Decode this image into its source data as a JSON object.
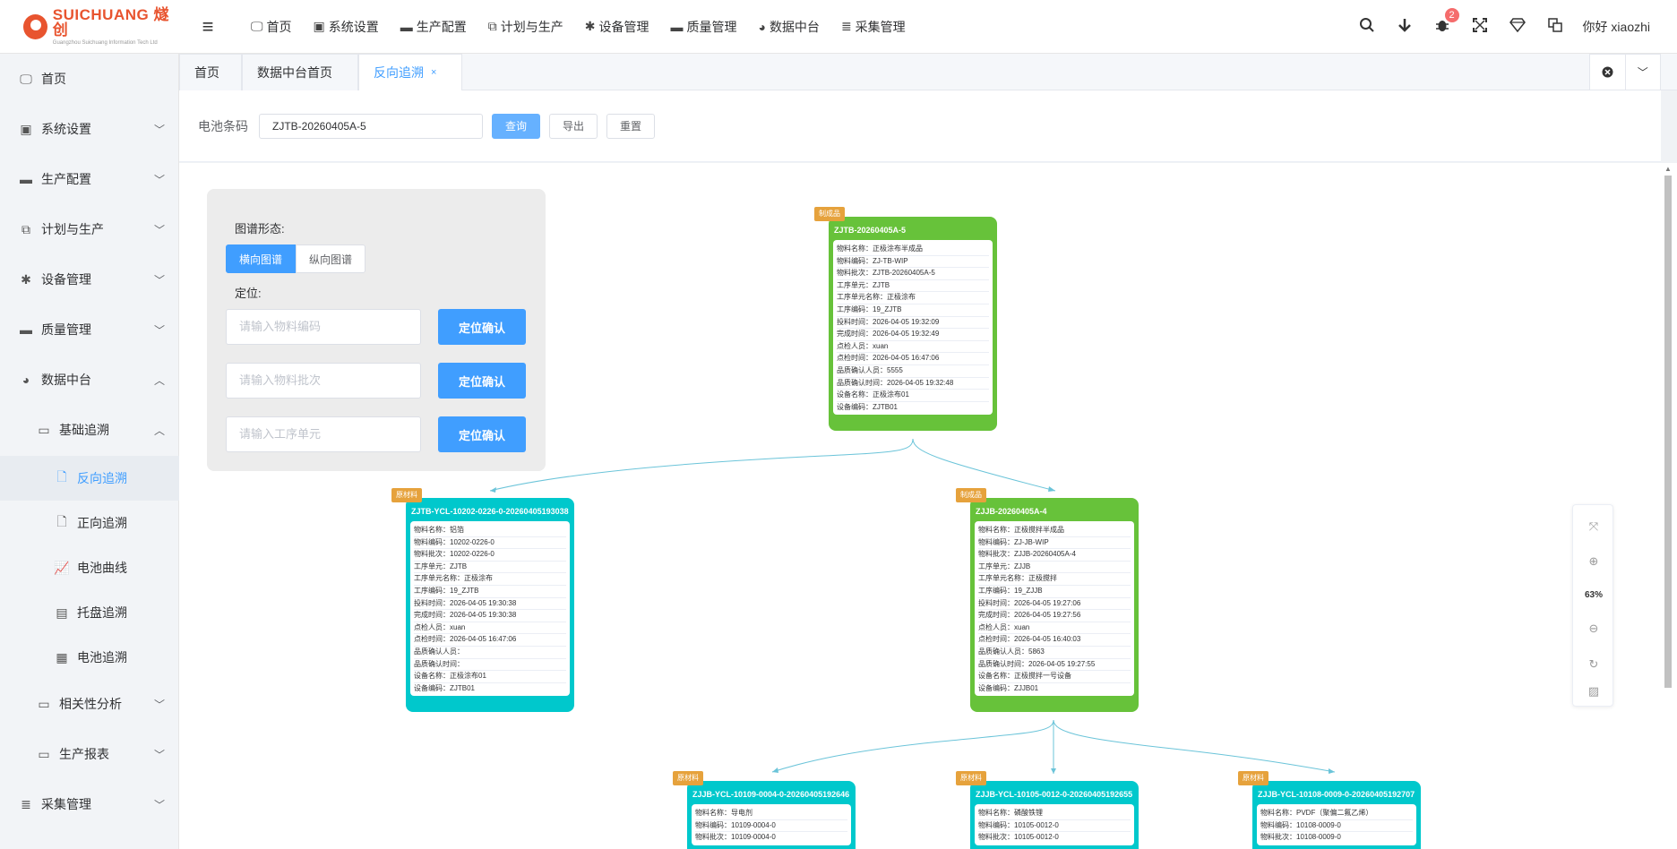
{
  "header": {
    "brand": "SUICHUANG 燧创",
    "brand_sub": "Guangzhou Suichuang Information Tech Ltd",
    "nav": [
      {
        "label": "首页",
        "icon": "monitor-icon",
        "glyph": "🖵"
      },
      {
        "label": "系统设置",
        "icon": "user-settings-icon",
        "glyph": "▣"
      },
      {
        "label": "生产配置",
        "icon": "briefcase-icon",
        "glyph": "▬"
      },
      {
        "label": "计划与生产",
        "icon": "windows-icon",
        "glyph": "⧉"
      },
      {
        "label": "设备管理",
        "icon": "gear-icon",
        "glyph": "✱"
      },
      {
        "label": "质量管理",
        "icon": "briefcase-icon",
        "glyph": "▬"
      },
      {
        "label": "数据中台",
        "icon": "pie-chart-icon",
        "glyph": "◕"
      },
      {
        "label": "采集管理",
        "icon": "database-icon",
        "glyph": "≣"
      }
    ],
    "notification_count": "2",
    "greeting": "你好 xiaozhi"
  },
  "sidebar": {
    "items": [
      {
        "label": "首页",
        "glyph": "🖵"
      },
      {
        "label": "系统设置",
        "glyph": "▣"
      },
      {
        "label": "生产配置",
        "glyph": "▬"
      },
      {
        "label": "计划与生产",
        "glyph": "⧉"
      },
      {
        "label": "设备管理",
        "glyph": "✱"
      },
      {
        "label": "质量管理",
        "glyph": "▬"
      },
      {
        "label": "数据中台",
        "glyph": "◕"
      },
      {
        "label": "基础追溯",
        "glyph": "▭"
      },
      {
        "label": "反向追溯",
        "glyph": "🗋"
      },
      {
        "label": "正向追溯",
        "glyph": "🗋"
      },
      {
        "label": "电池曲线",
        "glyph": "📈"
      },
      {
        "label": "托盘追溯",
        "glyph": "▤"
      },
      {
        "label": "电池追溯",
        "glyph": "▦"
      },
      {
        "label": "相关性分析",
        "glyph": "▭"
      },
      {
        "label": "生产报表",
        "glyph": "▭"
      },
      {
        "label": "采集管理",
        "glyph": "≣"
      }
    ]
  },
  "tabs": [
    {
      "label": "首页"
    },
    {
      "label": "数据中台首页"
    },
    {
      "label": "反向追溯",
      "close": "×"
    }
  ],
  "search": {
    "label": "电池条码",
    "value": "ZJTB-20260405A-5",
    "query": "查询",
    "export": "导出",
    "reset": "重置"
  },
  "control_panel": {
    "form_label": "图谱形态:",
    "horizontal": "横向图谱",
    "vertical": "纵向图谱",
    "locate_label": "定位:",
    "placeholders": [
      "请输入物料编码",
      "请输入物料批次",
      "请输入工序单元"
    ],
    "confirm": "定位确认"
  },
  "zoom": {
    "percent": "63%"
  },
  "nodes": [
    {
      "tag": "制成品",
      "title": "ZJTB-20260405A-5",
      "color": "#67c23a",
      "rows": [
        "物料名称：正极涂布半成品",
        "物料编码：ZJ-TB-WIP",
        "物料批次：ZJTB-20260405A-5",
        "工序单元：ZJTB",
        "工序单元名称：正极涂布",
        "工序编码：19_ZJTB",
        "投料时间：2026-04-05 19:32:09",
        "完成时间：2026-04-05 19:32:49",
        "点检人员：xuan",
        "点检时间：2026-04-05 16:47:06",
        "品质确认人员：5555",
        "品质确认时间：2026-04-05 19:32:48",
        "设备名称：正极涂布01",
        "设备编码：ZJTB01"
      ]
    },
    {
      "tag": "原材料",
      "title": "ZJTB-YCL-10202-0226-0-20260405193038",
      "color": "#00c8cc",
      "rows": [
        "物料名称：铝箔",
        "物料编码：10202-0226-0",
        "物料批次：10202-0226-0",
        "工序单元：ZJTB",
        "工序单元名称：正极涂布",
        "工序编码：19_ZJTB",
        "投料时间：2026-04-05 19:30:38",
        "完成时间：2026-04-05 19:30:38",
        "点检人员：xuan",
        "点检时间：2026-04-05 16:47:06",
        "品质确认人员：",
        "品质确认时间：",
        "设备名称：正极涂布01",
        "设备编码：ZJTB01"
      ]
    },
    {
      "tag": "制成品",
      "title": "ZJJB-20260405A-4",
      "color": "#67c23a",
      "rows": [
        "物料名称：正极搅拌半成品",
        "物料编码：ZJ-JB-WIP",
        "物料批次：ZJJB-20260405A-4",
        "工序单元：ZJJB",
        "工序单元名称：正极搅拌",
        "工序编码：19_ZJJB",
        "投料时间：2026-04-05 19:27:06",
        "完成时间：2026-04-05 19:27:56",
        "点检人员：xuan",
        "点检时间：2026-04-05 16:40:03",
        "品质确认人员：5863",
        "品质确认时间：2026-04-05 19:27:55",
        "设备名称：正极搅拌一号设备",
        "设备编码：ZJJB01"
      ]
    },
    {
      "tag": "原材料",
      "title": "ZJJB-YCL-10109-0004-0-20260405192646",
      "color": "#00c8cc",
      "rows": [
        "物料名称：导电剂",
        "物料编码：10109-0004-0",
        "物料批次：10109-0004-0"
      ]
    },
    {
      "tag": "原材料",
      "title": "ZJJB-YCL-10105-0012-0-20260405192655",
      "color": "#00c8cc",
      "rows": [
        "物料名称：磷酸铁锂",
        "物料编码：10105-0012-0",
        "物料批次：10105-0012-0"
      ]
    },
    {
      "tag": "原材料",
      "title": "ZJJB-YCL-10108-0009-0-20260405192707",
      "color": "#00c8cc",
      "rows": [
        "物料名称：PVDF（聚偏二氟乙烯）",
        "物料编码：10108-0009-0",
        "物料批次：10108-0009-0"
      ]
    }
  ]
}
